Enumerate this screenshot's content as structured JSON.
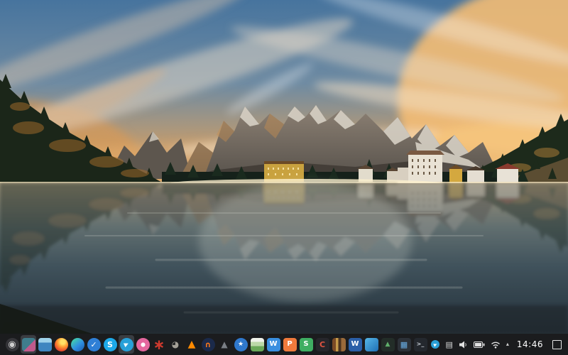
{
  "desktop": {
    "colors": {
      "dock_bg": "#1b1c1e",
      "active_tile_bg": "#3a3d42",
      "clock_color": "#ffffff"
    }
  },
  "dock": {
    "apps": [
      {
        "id": "launcher",
        "shape": "circle",
        "bg": "#343438",
        "glyph": "◉",
        "glyph_color": "#cfcfcf",
        "size": 13
      },
      {
        "id": "screen-share",
        "shape": "square",
        "bg": "linear-gradient(135deg,#3f7d8c 0 55%,#c05a8c 55%)",
        "active": true
      },
      {
        "id": "file-manager",
        "shape": "square",
        "bg": "linear-gradient(180deg,#9fd2ea 0 35%,#3f86c0 35%)"
      },
      {
        "id": "firefox",
        "shape": "circle",
        "bg": "radial-gradient(circle at 60% 30%,#ffe066 0 18%,#ff9e33 40%,#e84e2e 70%,#c22f33 100%)"
      },
      {
        "id": "edge",
        "shape": "circle",
        "bg": "linear-gradient(140deg,#45d6a8 10%,#2f8fe0 55%,#1a58a8)"
      },
      {
        "id": "ticktick",
        "shape": "circle",
        "bg": "#2f7fd6",
        "glyph": "✓",
        "glyph_color": "#ffffff",
        "size": 11
      },
      {
        "id": "skype",
        "shape": "circle",
        "bg": "#1da9e8",
        "glyph": "S",
        "glyph_color": "#ffffff",
        "size": 11
      },
      {
        "id": "telegram",
        "shape": "circle",
        "bg": "#27a0d8",
        "glyph": "▶",
        "glyph_color": "#ffffff",
        "size": 8,
        "rotate": -25,
        "active": true
      },
      {
        "id": "deepin-music",
        "shape": "circle",
        "bg": "radial-gradient(circle,#ffffff 0 22%,#e4679e 23%)"
      },
      {
        "id": "starburst-app",
        "shape": "plain",
        "glyph": "∗",
        "glyph_color": "#cf3a2e",
        "size": 20
      },
      {
        "id": "gimp",
        "shape": "plain",
        "glyph": "◕",
        "glyph_color": "#a39f96",
        "size": 12
      },
      {
        "id": "vlc",
        "shape": "plain",
        "glyph": "▲",
        "glyph_color": "#ff8a00",
        "size": 14
      },
      {
        "id": "audacity",
        "shape": "circle",
        "bg": "#1b2a4a",
        "glyph": "∩",
        "glyph_color": "#ff7a1a",
        "size": 11
      },
      {
        "id": "rocket-app",
        "shape": "plain",
        "glyph": "▲",
        "glyph_color": "#7a7f85",
        "size": 12
      },
      {
        "id": "app-store",
        "shape": "circle",
        "bg": "#2f78cc",
        "glyph": "★",
        "glyph_color": "#ffffff",
        "size": 9
      },
      {
        "id": "draw-app",
        "shape": "square",
        "bg": "linear-gradient(180deg,#f0f2ea 0 30%,#bcd8a8 30% 60%,#6aa858 60%)"
      },
      {
        "id": "wps-writer",
        "shape": "square",
        "bg": "#3a8fe0",
        "glyph": "W",
        "glyph_color": "#ffffff",
        "size": 10
      },
      {
        "id": "wps-presentation",
        "shape": "square",
        "bg": "#f07a3c",
        "glyph": "P",
        "glyph_color": "#ffffff",
        "size": 10
      },
      {
        "id": "wps-spreadsheet",
        "shape": "square",
        "bg": "#3fae62",
        "glyph": "S",
        "glyph_color": "#ffffff",
        "size": 10
      },
      {
        "id": "media-app",
        "shape": "square",
        "bg": "#26262b",
        "glyph": "C",
        "glyph_color": "#e05340",
        "size": 11
      },
      {
        "id": "library-app",
        "shape": "square",
        "bg": "linear-gradient(90deg,#7a4a26 0 25%,#c49a4a 25% 45%,#4a3320 45% 65%,#9a6a3a 65%)"
      },
      {
        "id": "word-app",
        "shape": "square",
        "bg": "#2b5fa8",
        "glyph": "W",
        "glyph_color": "#ffffff",
        "size": 10
      },
      {
        "id": "blue-app",
        "shape": "square",
        "bg": "linear-gradient(135deg,#56b7e8,#1f6fb4)"
      },
      {
        "id": "image-viewer",
        "shape": "square",
        "bg": "#232d28",
        "glyph": "▲",
        "glyph_color": "#5fae6a",
        "size": 9
      },
      {
        "id": "calculator",
        "shape": "square",
        "bg": "#2c3138",
        "glyph": "▦",
        "glyph_color": "#6ab0e8",
        "size": 11
      },
      {
        "id": "terminal",
        "shape": "square",
        "bg": "#24282e",
        "glyph": ">_",
        "glyph_color": "#c8ced6",
        "size": 8
      }
    ]
  },
  "tray": {
    "clock": "14:46",
    "icons": [
      "telegram-tray",
      "input-method",
      "volume",
      "battery",
      "wifi",
      "expand",
      "show-desktop"
    ]
  }
}
